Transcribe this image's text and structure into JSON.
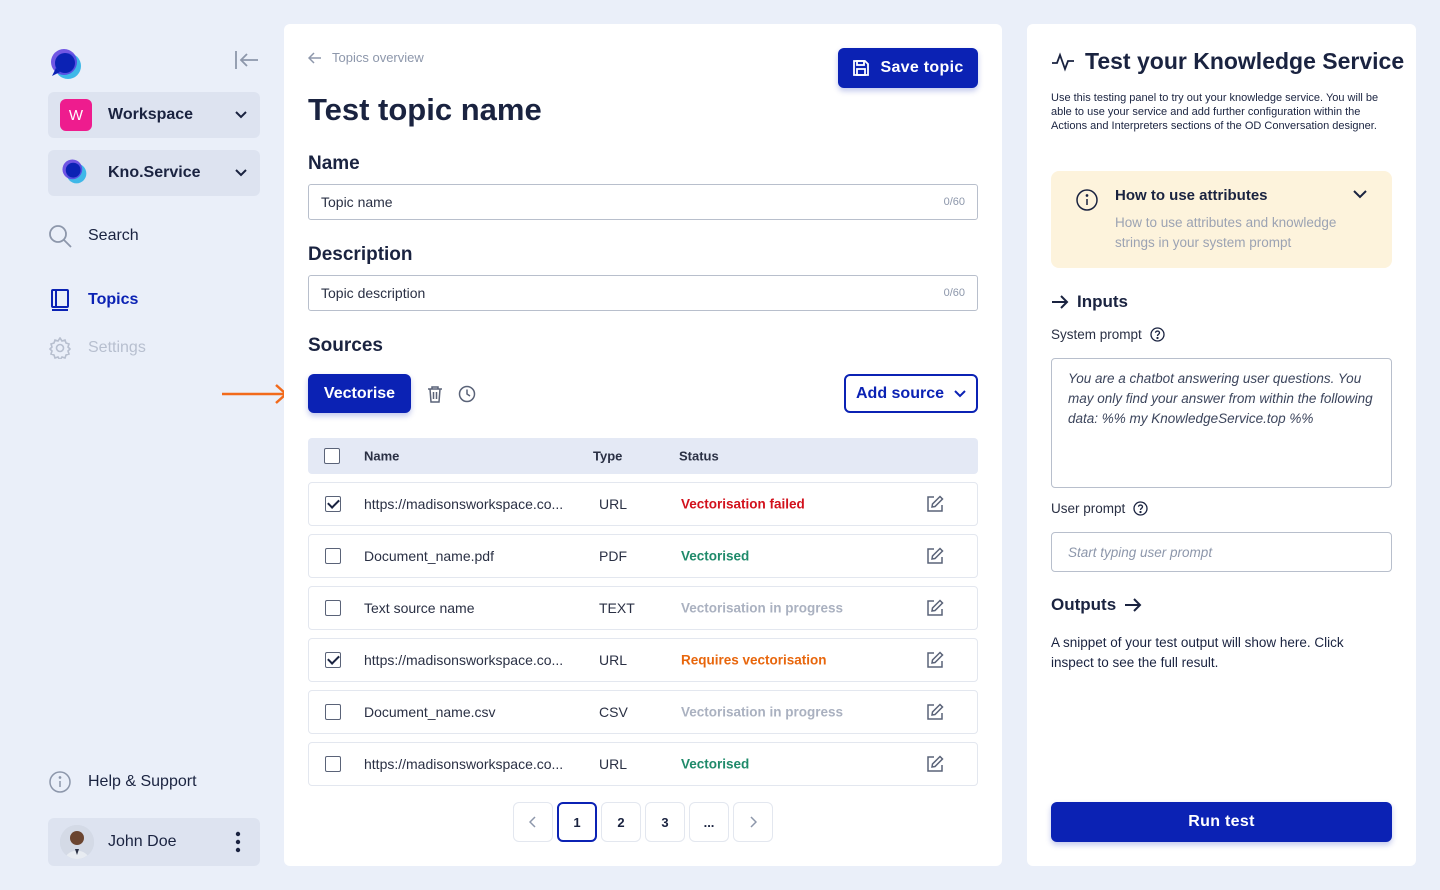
{
  "sidebar": {
    "workspace": {
      "badge": "W",
      "label": "Workspace"
    },
    "service": {
      "label": "Kno.Service"
    },
    "nav": {
      "search": "Search",
      "topics": "Topics",
      "settings": "Settings",
      "help": "Help & Support"
    },
    "user": {
      "name": "John Doe"
    }
  },
  "main": {
    "breadcrumb": "Topics overview",
    "save_label": "Save topic",
    "title": "Test topic name",
    "name": {
      "label": "Name",
      "value": "Topic name",
      "count": "0/60"
    },
    "description": {
      "label": "Description",
      "value": "Topic description",
      "count": "0/60"
    },
    "sources": {
      "label": "Sources",
      "vectorise_label": "Vectorise",
      "add_source_label": "Add source",
      "columns": {
        "name": "Name",
        "type": "Type",
        "status": "Status"
      },
      "rows": [
        {
          "checked": true,
          "name": "https://madisonsworkspace.co...",
          "type": "URL",
          "status": "Vectorisation failed",
          "status_color": "#d2111c"
        },
        {
          "checked": false,
          "name": "Document_name.pdf",
          "type": "PDF",
          "status": "Vectorised",
          "status_color": "#1f8a6a"
        },
        {
          "checked": false,
          "name": "Text source name",
          "type": "TEXT",
          "status": "Vectorisation in progress",
          "status_color": "#aab1c0"
        },
        {
          "checked": true,
          "name": "https://madisonsworkspace.co...",
          "type": "URL",
          "status": "Requires vectorisation",
          "status_color": "#e8660c"
        },
        {
          "checked": false,
          "name": "Document_name.csv",
          "type": "CSV",
          "status": "Vectorisation in progress",
          "status_color": "#aab1c0"
        },
        {
          "checked": false,
          "name": "https://madisonsworkspace.co...",
          "type": "URL",
          "status": "Vectorised",
          "status_color": "#1f8a6a"
        }
      ]
    },
    "pagination": {
      "pages": [
        "1",
        "2",
        "3",
        "..."
      ],
      "current": "1"
    }
  },
  "test_panel": {
    "title": "Test your Knowledge Service",
    "description": "Use this testing panel to try out your knowledge service. You will be able to use your service and add further configuration within the Actions and Interpreters sections of the OD Conversation designer.",
    "info": {
      "title": "How to use attributes",
      "body": "How to use attributes and knowledge strings in your system prompt"
    },
    "inputs_heading": "Inputs",
    "system_prompt": {
      "label": "System prompt",
      "value": "You are a chatbot answering user questions. You may only find your answer from within the following data: %% my KnowledgeService.top %%"
    },
    "user_prompt": {
      "label": "User prompt",
      "placeholder": "Start typing user prompt"
    },
    "outputs_heading": "Outputs",
    "outputs_description": "A snippet of your test output will show here. Click inspect to see the full result.",
    "run_label": "Run test"
  },
  "colors": {
    "primary": "#0b22b4",
    "background": "#eaeff9",
    "annotation_arrow": "#f26a1b",
    "info_bg": "#fdf3dc"
  }
}
